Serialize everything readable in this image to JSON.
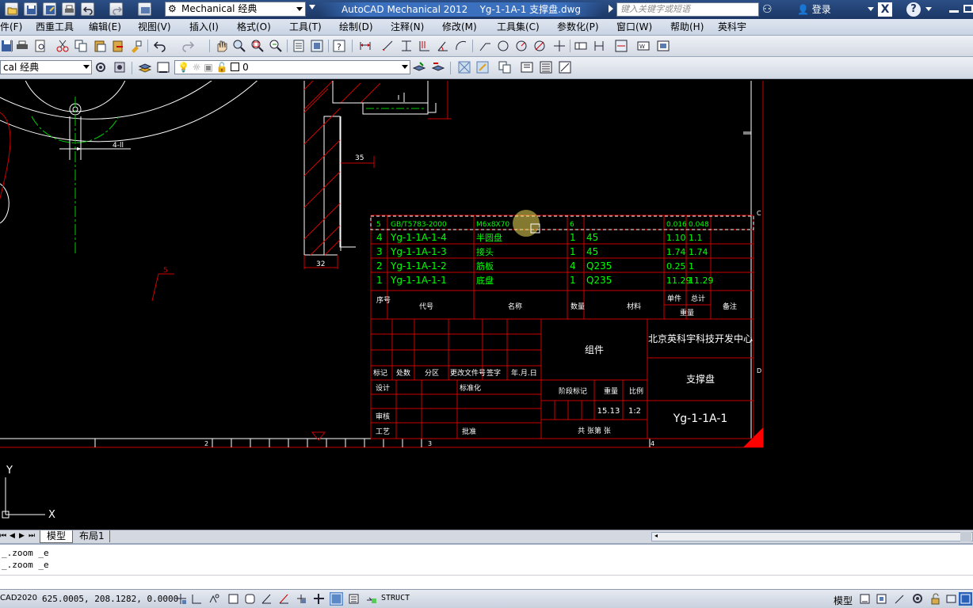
{
  "titlebar": {
    "workspace": "Mechanical 经典",
    "app_title": "AutoCAD Mechanical 2012",
    "document": "Yg-1-1A-1 支撑盘.dwg",
    "search_placeholder": "键入关键字或短语",
    "login": "登录"
  },
  "menu": [
    "件(F)",
    "西重工具",
    "编辑(E)",
    "视图(V)",
    "插入(I)",
    "格式(O)",
    "工具(T)",
    "绘制(D)",
    "注释(N)",
    "修改(M)",
    "工具集(C)",
    "参数化(P)",
    "窗口(W)",
    "帮助(H)",
    "英科宇"
  ],
  "toolbar": {
    "workspace_combo": "cal 经典",
    "layer_combo": "0"
  },
  "drawing": {
    "dims": {
      "d1": "4-ll",
      "d2": "35",
      "d3": "32",
      "d4": "5"
    },
    "bom_rows": [
      {
        "no": "5",
        "code": "GB/T5783-2000",
        "name": "M6x8X70",
        "qty": "6",
        "material": "",
        "w1": "0.016",
        "w2": "0.048"
      },
      {
        "no": "4",
        "code": "Yg-1-1A-1-4",
        "name": "半圆盘",
        "qty": "1",
        "material": "45",
        "w1": "1.10",
        "w2": "1.1"
      },
      {
        "no": "3",
        "code": "Yg-1-1A-1-3",
        "name": "接头",
        "qty": "1",
        "material": "45",
        "w1": "1.74",
        "w2": "1.74"
      },
      {
        "no": "2",
        "code": "Yg-1-1A-1-2",
        "name": "筋板",
        "qty": "4",
        "material": "Q235",
        "w1": "0.25",
        "w2": "1"
      },
      {
        "no": "1",
        "code": "Yg-1-1A-1-1",
        "name": "底盘",
        "qty": "1",
        "material": "Q235",
        "w1": "11.29",
        "w2": "11.29"
      }
    ],
    "bom_header": {
      "no": "序号",
      "code": "代号",
      "name": "名称",
      "qty": "数量",
      "material": "材料",
      "unit": "单件",
      "total": "总计",
      "weight": "重量",
      "note": "备注"
    },
    "titleblock": {
      "assembly": "组件",
      "company": "北京英科宇科技开发中心",
      "part_name": "支撑盘",
      "drawing_no": "Yg-1-1A-1",
      "stage_mark": "阶段标记",
      "weight_label": "重量",
      "scale_label": "比例",
      "weight": "15.13",
      "scale": "1:2",
      "sheet": "共  张第  张",
      "sig_row": [
        "标记",
        "处数",
        "分区",
        "更改文件号",
        "签字",
        "年.月.日"
      ],
      "design": "设计",
      "standard": "标准化",
      "review": "审核",
      "process": "工艺",
      "approve": "批准"
    },
    "frame_zones": {
      "z2": "2",
      "z3": "3",
      "z4": "4",
      "zC": "C",
      "zD": "D"
    },
    "ucs": {
      "x": "X",
      "y": "Y"
    }
  },
  "tabs": {
    "model": "模型",
    "layout1": "布局1"
  },
  "command_history": [
    "_.zoom _e",
    "_.zoom _e"
  ],
  "status": {
    "left_label": "CAD2020",
    "coords": "625.0005, 208.1282, 0.0000",
    "struct": "STRUCT",
    "model": "模型"
  }
}
